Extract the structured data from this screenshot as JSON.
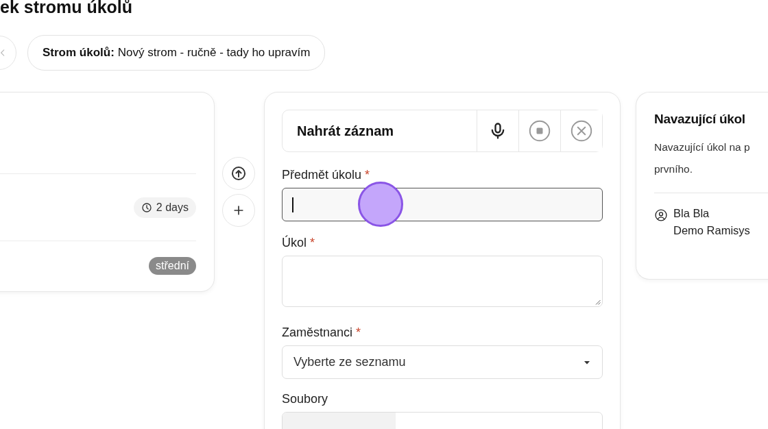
{
  "page": {
    "title": "ek stromu úkolů"
  },
  "breadcrumb": {
    "label": "Strom úkolů:",
    "value": "Nový strom - ručně - tady ho upravím"
  },
  "left_card": {
    "duration": "2 days",
    "priority": "střední"
  },
  "form": {
    "recorder": {
      "label": "Nahrát záznam"
    },
    "fields": [
      {
        "kind": "input",
        "label": "Předmět úkolu",
        "required_mark": "*",
        "focused": true
      },
      {
        "kind": "textarea",
        "label": "Úkol",
        "required_mark": "*",
        "focused": false
      },
      {
        "kind": "select",
        "label": "Zaměstnanci",
        "required_mark": "*",
        "placeholder": "Vyberte ze seznamu",
        "focused": false
      },
      {
        "kind": "file",
        "label": "Soubory",
        "focused": false
      }
    ]
  },
  "next_card": {
    "title": "Navazující úkol",
    "text": "Navazující úkol na p prvního.",
    "person": "Bla Bla",
    "company": "Demo Ramisys"
  }
}
